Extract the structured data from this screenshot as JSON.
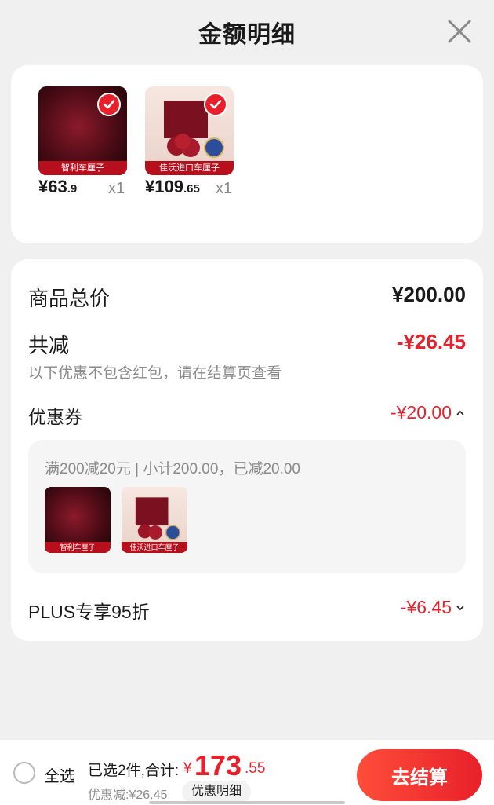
{
  "header": {
    "title": "金额明细",
    "close_icon": "close-icon"
  },
  "products": [
    {
      "price_int": "¥63",
      "price_dec": ".9",
      "qty": "x1",
      "tag": "智利车厘子",
      "selected": true
    },
    {
      "price_int": "¥109",
      "price_dec": ".65",
      "qty": "x1",
      "tag": "佳沃进口车厘子",
      "selected": true
    }
  ],
  "summary": {
    "total_label": "商品总价",
    "total_value": "¥200.00",
    "reduce_label": "共减",
    "reduce_value": "-¥26.45",
    "note": "以下优惠不包含红包，请在结算页查看",
    "coupon_label": "优惠券",
    "coupon_value": "-¥20.00",
    "coupon_desc": "满200减20元 | 小计200.00，已减20.00",
    "plus_label": "PLUS专享95折",
    "plus_value": "-¥6.45"
  },
  "bottom": {
    "select_all": "全选",
    "selected_count": "已选2件,合计:",
    "total_symbol": "¥",
    "total_int": "173",
    "total_dec": ".55",
    "discount": "优惠减:¥26.45",
    "detail_label": "优惠明细",
    "checkout_label": "去结算"
  },
  "colors": {
    "accent": "#e8202a",
    "muted": "#8a8a8a",
    "background": "#f0f0f0"
  }
}
